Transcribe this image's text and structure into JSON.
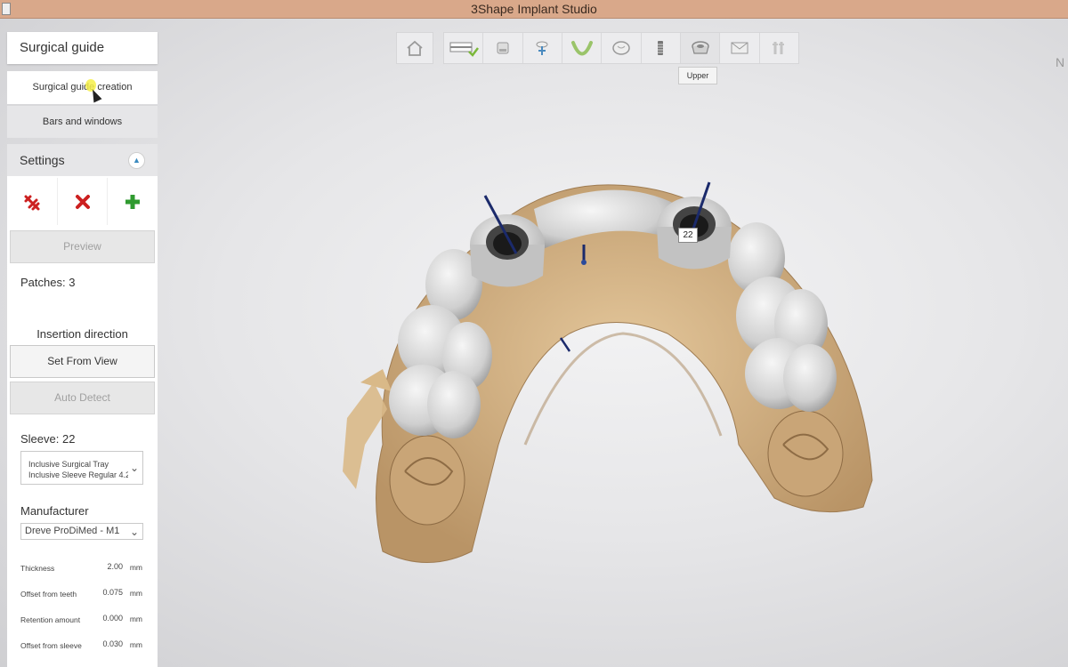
{
  "window": {
    "title": "3Shape Implant Studio"
  },
  "sidebar": {
    "header": "Surgical guide",
    "subnav": [
      {
        "label": "Surgical guide creation",
        "active": true
      },
      {
        "label": "Bars and windows",
        "active": false
      }
    ],
    "settings": {
      "title": "Settings",
      "tools": [
        {
          "icon": "delete-all-icon"
        },
        {
          "icon": "delete-icon"
        },
        {
          "icon": "add-icon"
        }
      ],
      "preview_button": "Preview",
      "patches": "Patches: 3",
      "insertion_direction_label": "Insertion direction",
      "set_from_view_button": "Set From View",
      "auto_detect_button": "Auto Detect",
      "sleeve_label": "Sleeve: 22",
      "sleeve_option_line1": "Inclusive Surgical Tray",
      "sleeve_option_line2": "Inclusive Sleeve Regular 4.2",
      "manufacturer_label": "Manufacturer",
      "manufacturer_value": "Dreve ProDiMed - M1",
      "properties": [
        {
          "name": "Thickness",
          "value": "2.00",
          "unit": "mm"
        },
        {
          "name": "Offset from teeth",
          "value": "0.075",
          "unit": "mm"
        },
        {
          "name": "Retention amount",
          "value": "0.000",
          "unit": "mm"
        },
        {
          "name": "Offset from sleeve",
          "value": "0.030",
          "unit": "mm"
        }
      ]
    }
  },
  "toolbar": {
    "home_icon": "home-icon",
    "steps": [
      {
        "icon": "scan-step-icon",
        "done": true
      },
      {
        "icon": "model-step-icon"
      },
      {
        "icon": "planning-step-icon"
      },
      {
        "icon": "arch-step-icon"
      },
      {
        "icon": "tooth-step-icon"
      },
      {
        "icon": "implant-step-icon"
      },
      {
        "icon": "guide-step-icon",
        "current": true
      },
      {
        "icon": "envelope-step-icon"
      },
      {
        "icon": "sleeve-step-icon"
      }
    ],
    "tooltip": "Upper"
  },
  "viewport": {
    "implant_label": "22",
    "edge_text": "N"
  },
  "colors": {
    "titlebar": "#d9a88a",
    "accent": "#3a8abf",
    "delete": "#cc2020",
    "add": "#2f9a2f",
    "model": "#d8b98a",
    "guide": "#c9c9c9"
  }
}
